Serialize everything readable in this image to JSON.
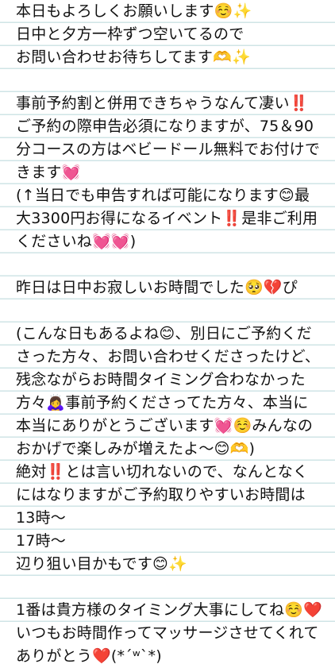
{
  "note": {
    "lines": [
      "本日もよろしくお願いします☺️✨",
      "日中と夕方一枠ずつ空いてるので",
      "お問い合わせお待ちしてます🫶✨",
      "",
      "事前予約割と併用できちゃうなんて凄い‼️",
      "ご予約の際申告必須になりますが、75＆90",
      "分コースの方はベビードール無料でお付けで",
      "きます💓",
      "(↑当日でも申告すれば可能になります😊最",
      "大3300円お得になるイベント‼️是非ご利用",
      "くださいね💓💓)",
      "",
      "昨日は日中お寂しいお時間でした🥺💔ぴ",
      "",
      "(こんな日もあるよね😊、別日にご予約くだ",
      "さった方々、お問い合わせくださったけど、",
      "残念ながらお時間タイミング合わなかった",
      "方々🙇‍♀️事前予約くださってた方々、本当に",
      "本当にありがとうございます💓☺️みんなの",
      "おかげで楽しみが増えたよ〜😊🫶)",
      "絶対‼️とは言い切れないので、なんとなく",
      "にはなりますがご予約取りやすいお時間は",
      "13時〜",
      "17時〜",
      "辺り狙い目かもです😊✨",
      "",
      "1番は貴方様のタイミング大事にしてね☺️❤️",
      "いつもお時間作ってマッサージさせてくれて",
      "ありがとう❤️(*´ʷ`*)"
    ]
  }
}
